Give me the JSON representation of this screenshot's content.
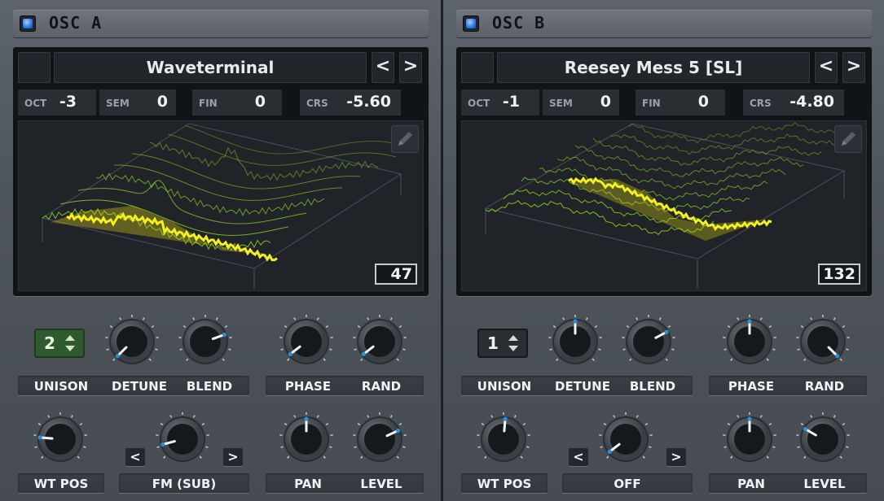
{
  "colors": {
    "accent_yellow": "#f2f01e",
    "wave_green": "#8ccc2a",
    "knob_indicator": "#2a90d8"
  },
  "osc_a": {
    "title": "OSC A",
    "wavetable_name": "Waveterminal",
    "prev_label": "<",
    "next_label": ">",
    "oct": {
      "label": "OCT",
      "value": "-3"
    },
    "sem": {
      "label": "SEM",
      "value": "0"
    },
    "fin": {
      "label": "FIN",
      "value": "0"
    },
    "crs": {
      "label": "CRS",
      "value": "-5.60"
    },
    "frame": "47",
    "unison": {
      "label": "UNISON",
      "value": "2"
    },
    "detune": {
      "label": "DETUNE"
    },
    "blend": {
      "label": "BLEND"
    },
    "phase": {
      "label": "PHASE"
    },
    "rand": {
      "label": "RAND"
    },
    "wt_pos": {
      "label": "WT POS"
    },
    "fm": {
      "label": "FM (SUB)",
      "prev": "<",
      "next": ">"
    },
    "pan": {
      "label": "PAN"
    },
    "level": {
      "label": "LEVEL"
    }
  },
  "osc_b": {
    "title": "OSC B",
    "wavetable_name": "Reesey Mess 5 [SL]",
    "prev_label": "<",
    "next_label": ">",
    "oct": {
      "label": "OCT",
      "value": "-1"
    },
    "sem": {
      "label": "SEM",
      "value": "0"
    },
    "fin": {
      "label": "FIN",
      "value": "0"
    },
    "crs": {
      "label": "CRS",
      "value": "-4.80"
    },
    "frame": "132",
    "unison": {
      "label": "UNISON",
      "value": "1"
    },
    "detune": {
      "label": "DETUNE"
    },
    "blend": {
      "label": "BLEND"
    },
    "phase": {
      "label": "PHASE"
    },
    "rand": {
      "label": "RAND"
    },
    "wt_pos": {
      "label": "WT POS"
    },
    "fm": {
      "label": "OFF",
      "prev": "<",
      "next": ">"
    },
    "pan": {
      "label": "PAN"
    },
    "level": {
      "label": "LEVEL"
    }
  }
}
